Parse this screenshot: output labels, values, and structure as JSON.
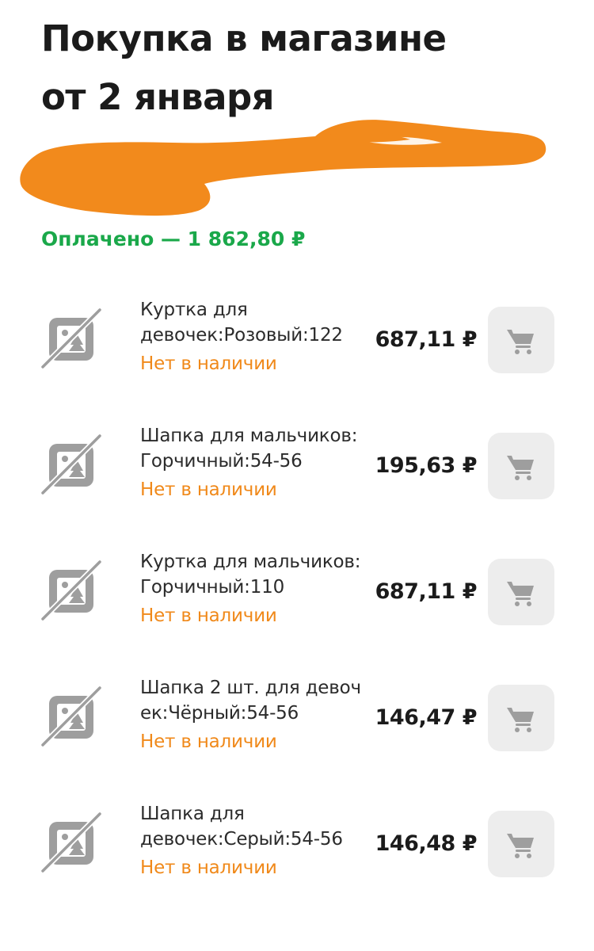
{
  "header": {
    "title_line1": "Покупка в магазине",
    "title_line2": "от 2 января"
  },
  "order": {
    "status": "Оплачено — 1 862,80 ₽"
  },
  "items": [
    {
      "name_line1": "Куртка для",
      "name_line2": "девочек:Розовый:122",
      "availability": "Нет в наличии",
      "price": "687,11 ₽"
    },
    {
      "name_line1": "Шапка для мальчиков:",
      "name_line2": "Горчичный:54-56",
      "availability": "Нет в наличии",
      "price": "195,63 ₽"
    },
    {
      "name_line1": "Куртка для мальчиков:",
      "name_line2": "Горчичный:110",
      "availability": "Нет в наличии",
      "price": "687,11 ₽"
    },
    {
      "name_line1": "Шапка 2 шт. для девоч",
      "name_line2": "ек:Чёрный:54-56",
      "availability": "Нет в наличии",
      "price": "146,47 ₽"
    },
    {
      "name_line1": "Шапка для",
      "name_line2": "девочек:Серый:54-56",
      "availability": "Нет в наличии",
      "price": "146,48 ₽"
    }
  ],
  "icons": {
    "thumbnail": "no-image-icon",
    "cart": "cart-icon"
  },
  "colors": {
    "paid_green": "#1aa84a",
    "availability_orange": "#f0891a",
    "redaction_orange": "#f28a1c",
    "button_bg": "#ededed",
    "icon_gray": "#9e9e9e"
  }
}
